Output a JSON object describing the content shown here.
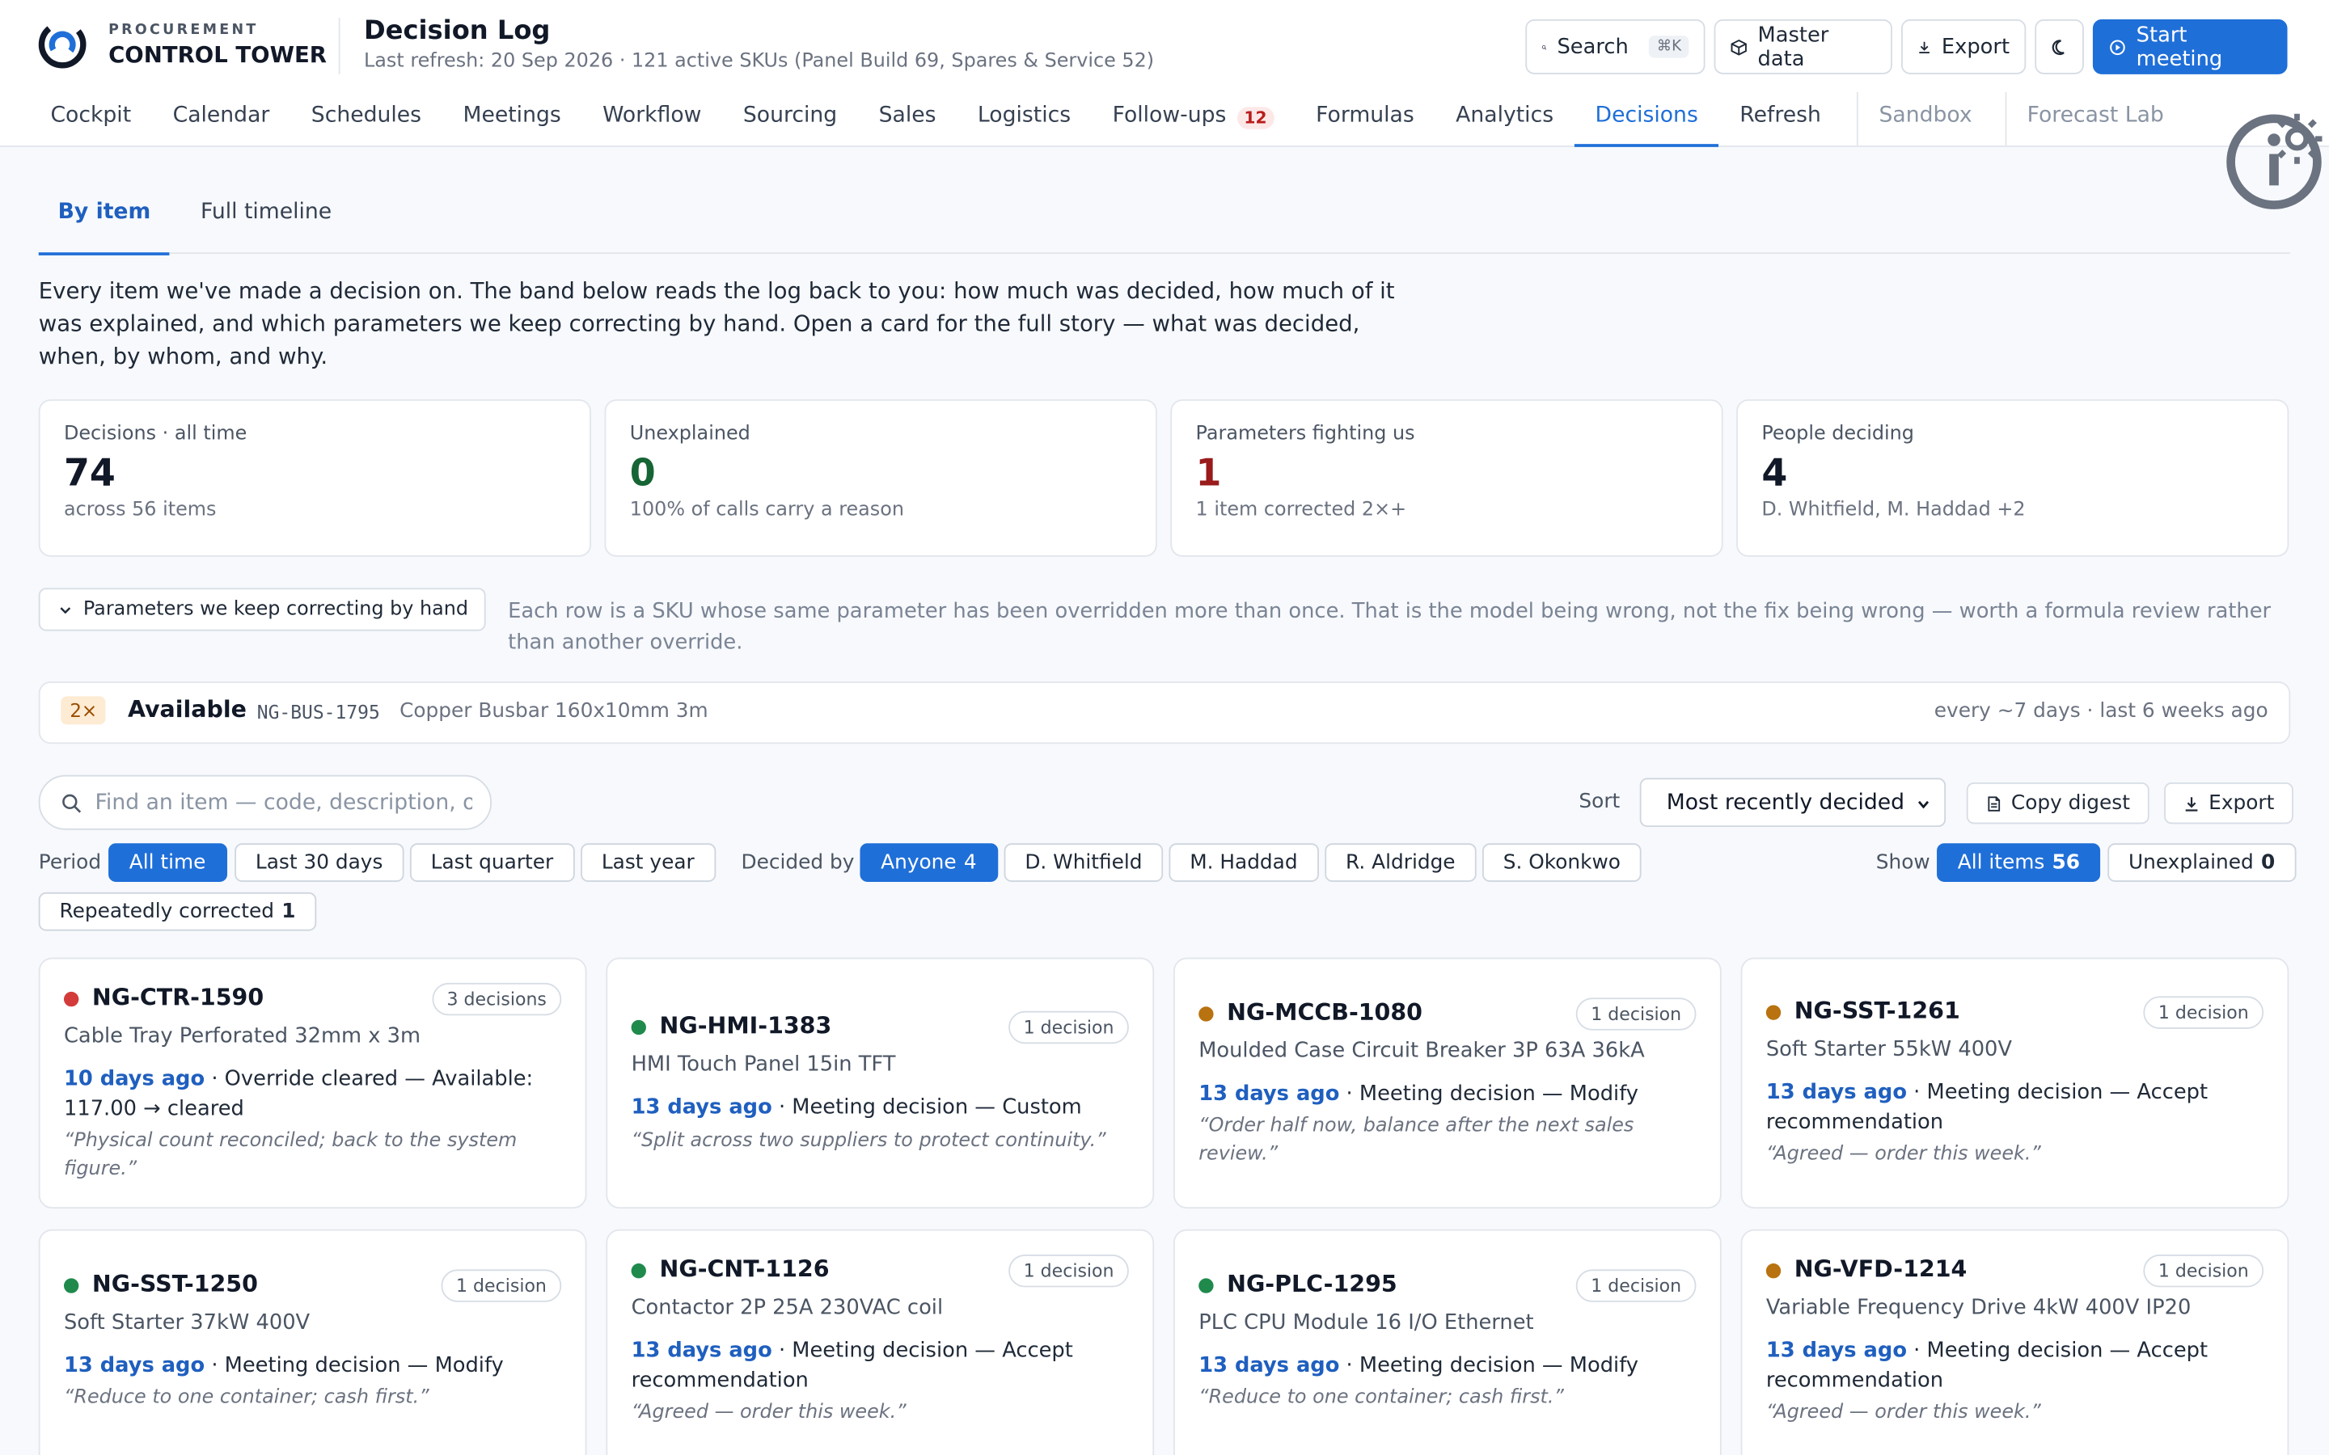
{
  "brand": {
    "small": "PROCUREMENT",
    "big": "CONTROL TOWER"
  },
  "header": {
    "title": "Decision Log",
    "subtitle": "Last refresh: 20 Sep 2026 · 121 active SKUs (Panel Build 69, Spares & Service 52)",
    "search_label": "Search",
    "search_kbd": "⌘K",
    "master_data_label": "Master data",
    "export_label": "Export",
    "start_meeting_label": "Start meeting"
  },
  "nav": {
    "items": [
      "Cockpit",
      "Calendar",
      "Schedules",
      "Meetings",
      "Workflow",
      "Sourcing",
      "Sales",
      "Logistics",
      "Follow-ups",
      "Formulas",
      "Analytics",
      "Decisions",
      "Refresh"
    ],
    "followups_badge": "12",
    "extra": [
      "Sandbox",
      "Forecast Lab"
    ]
  },
  "subtabs": {
    "by_item": "By item",
    "full_timeline": "Full timeline"
  },
  "intro": "Every item we've made a decision on. The band below reads the log back to you: how much was decided, how much of it was explained, and which parameters we keep correcting by hand. Open a card for the full story — what was decided, when, by whom, and why.",
  "stats": [
    {
      "label": "Decisions · all time",
      "value": "74",
      "sub": "across 56 items"
    },
    {
      "label": "Unexplained",
      "value": "0",
      "sub": "100% of calls carry a reason"
    },
    {
      "label": "Parameters fighting us",
      "value": "1",
      "sub": "1 item corrected 2×+"
    },
    {
      "label": "People deciding",
      "value": "4",
      "sub": "D. Whitfield, M. Haddad +2"
    }
  ],
  "params": {
    "toggle_label": "Parameters we keep correcting by hand",
    "note": "Each row is a SKU whose same parameter has been overridden more than once. That is the model being wrong, not the fix being wrong — worth a formula review rather than another override.",
    "row": {
      "count": "2×",
      "param": "Available",
      "code": "NG-BUS-1795",
      "desc": "Copper Busbar 160x10mm 3m",
      "freq": "every ~7 days · last 6 weeks ago"
    }
  },
  "toolbar": {
    "search_placeholder": "Find an item — code, description, or reason",
    "sort_label": "Sort",
    "sort_value": "Most recently decided",
    "copy_digest_label": "Copy digest",
    "export_label": "Export"
  },
  "filters": {
    "period_label": "Period",
    "period": [
      "All time",
      "Last 30 days",
      "Last quarter",
      "Last year"
    ],
    "decided_by_label": "Decided by",
    "anyone_label": "Anyone",
    "anyone_count": "4",
    "people": [
      "D. Whitfield",
      "M. Haddad",
      "R. Aldridge",
      "S. Okonkwo"
    ],
    "show_label": "Show",
    "all_items_label": "All items",
    "all_items_count": "56",
    "unexplained_label": "Unexplained",
    "unexplained_count": "0",
    "repeated_label": "Repeatedly corrected",
    "repeated_count": "1"
  },
  "colors": {
    "red": "#d33b3b",
    "green": "#1f8a4c",
    "amber": "#b8720f",
    "accent": "#1f6fd8"
  },
  "cards": [
    {
      "code": "NG-CTR-1590",
      "count": "3 decisions",
      "desc": "Cable Tray Perforated 32mm x 3m",
      "ago": "10 days ago",
      "event": " · Override cleared — Available: 117.00 → cleared",
      "quote": "“Physical count reconciled; back to the system figure.”",
      "status": "red"
    },
    {
      "code": "NG-HMI-1383",
      "count": "1 decision",
      "desc": "HMI Touch Panel 15in TFT",
      "ago": "13 days ago",
      "event": " · Meeting decision — Custom",
      "quote": "“Split across two suppliers to protect continuity.”",
      "status": "green"
    },
    {
      "code": "NG-MCCB-1080",
      "count": "1 decision",
      "desc": "Moulded Case Circuit Breaker 3P 63A 36kA",
      "ago": "13 days ago",
      "event": " · Meeting decision — Modify",
      "quote": "“Order half now, balance after the next sales review.”",
      "status": "amber"
    },
    {
      "code": "NG-SST-1261",
      "count": "1 decision",
      "desc": "Soft Starter 55kW 400V",
      "ago": "13 days ago",
      "event": " · Meeting decision — Accept recommendation",
      "quote": "“Agreed — order this week.”",
      "status": "amber"
    },
    {
      "code": "NG-SST-1250",
      "count": "1 decision",
      "desc": "Soft Starter 37kW 400V",
      "ago": "13 days ago",
      "event": " · Meeting decision — Modify",
      "quote": "“Reduce to one container; cash first.”",
      "status": "green"
    },
    {
      "code": "NG-CNT-1126",
      "count": "1 decision",
      "desc": "Contactor 2P 25A 230VAC coil",
      "ago": "13 days ago",
      "event": " · Meeting decision — Accept recommendation",
      "quote": "“Agreed — order this week.”",
      "status": "green"
    },
    {
      "code": "NG-PLC-1295",
      "count": "1 decision",
      "desc": "PLC CPU Module 16 I/O Ethernet",
      "ago": "13 days ago",
      "event": " · Meeting decision — Modify",
      "quote": "“Reduce to one container; cash first.”",
      "status": "green"
    },
    {
      "code": "NG-VFD-1214",
      "count": "1 decision",
      "desc": "Variable Frequency Drive 4kW 400V IP20",
      "ago": "13 days ago",
      "event": " · Meeting decision — Accept recommendation",
      "quote": "“Agreed — order this week.”",
      "status": "amber"
    }
  ]
}
